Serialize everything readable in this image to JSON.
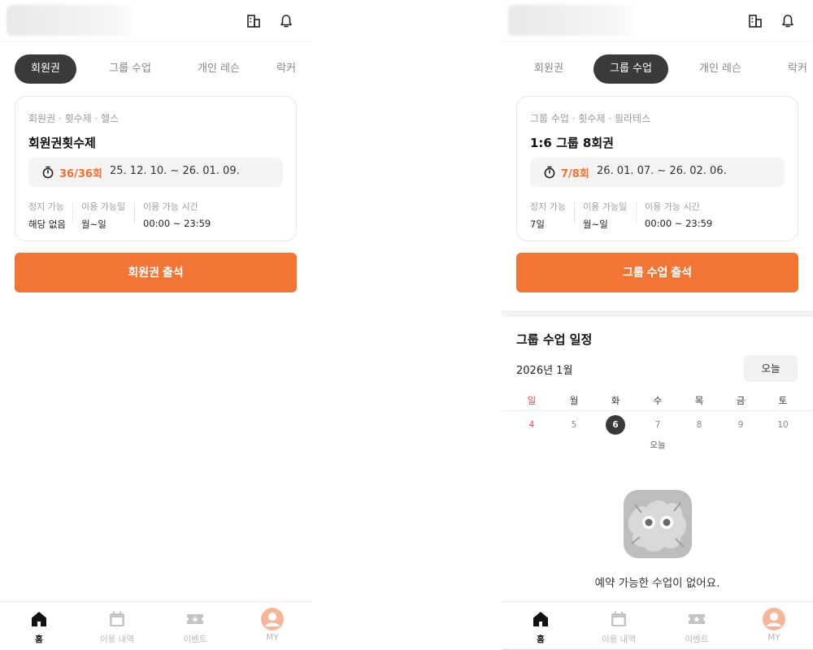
{
  "left": {
    "tabs": [
      "회원권",
      "그룹 수업",
      "개인 레슨",
      "락커"
    ],
    "active_tab": 0,
    "card": {
      "breadcrumb": "회원권 · 횟수제 · 헬스",
      "title": "회원권횟수제",
      "usage_count": "36/36회",
      "period": "25. 12. 10. ~ 26. 01. 09.",
      "info": [
        {
          "label": "정지 가능",
          "value": "해당 없음"
        },
        {
          "label": "이용 가능일",
          "value": "월~일"
        },
        {
          "label": "이용 가능 시간",
          "value": "00:00 ~ 23:59"
        }
      ]
    },
    "attend_button": "회원권 출석"
  },
  "right": {
    "tabs": [
      "회원권",
      "그룹 수업",
      "개인 레슨",
      "락커"
    ],
    "active_tab": 1,
    "card": {
      "breadcrumb": "그룹 수업 · 횟수제 · 필라테스",
      "title": "1:6 그룹 8회권",
      "usage_count": "7/8회",
      "period": "26. 01. 07. ~ 26. 02. 06.",
      "info": [
        {
          "label": "정지 가능",
          "value": "7일"
        },
        {
          "label": "이용 가능일",
          "value": "월~일"
        },
        {
          "label": "이용 가능 시간",
          "value": "00:00 ~ 23:59"
        }
      ]
    },
    "attend_button": "그룹 수업 출석",
    "schedule": {
      "title": "그룹 수업 일정",
      "month": "2026년 1월",
      "today_button": "오늘",
      "weekdays": [
        "일",
        "월",
        "화",
        "수",
        "목",
        "금",
        "토"
      ],
      "dates": [
        "4",
        "5",
        "6",
        "7",
        "8",
        "9",
        "10"
      ],
      "selected_date_index": 2,
      "today_marker": "오늘",
      "today_marker_index": 3,
      "empty_message": "예약 가능한 수업이 없어요."
    }
  },
  "bottom_nav": [
    {
      "label": "홈",
      "icon": "home-icon",
      "active": true
    },
    {
      "label": "이용 내역",
      "icon": "calendar-icon",
      "active": false
    },
    {
      "label": "이벤트",
      "icon": "ticket-icon",
      "active": false
    },
    {
      "label": "MY",
      "icon": "profile-icon",
      "active": false
    }
  ],
  "colors": {
    "accent": "#f47433",
    "count_text": "#f07030",
    "active_tab_bg": "#3a3a3a",
    "sunday": "#e04444",
    "avatar": "#f7b59a"
  }
}
